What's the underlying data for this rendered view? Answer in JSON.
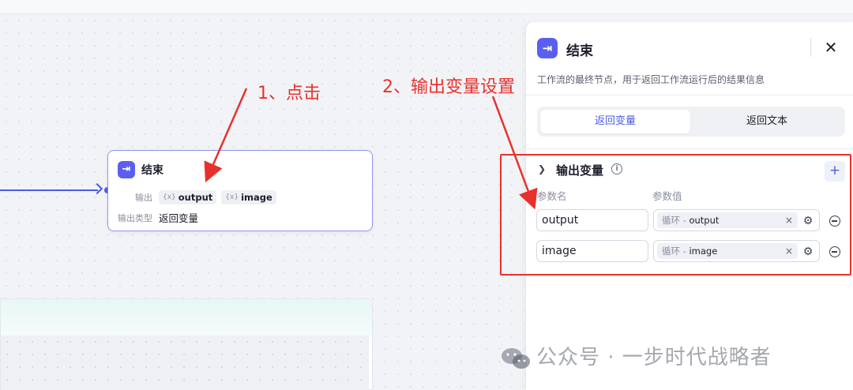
{
  "canvas": {
    "node": {
      "title": "结束",
      "output_label": "输出",
      "outputs": [
        "output",
        "image"
      ],
      "output_type_label": "输出类型",
      "output_type_value": "返回变量"
    }
  },
  "annotations": {
    "step1": "1、点击",
    "step2": "2、输出变量设置"
  },
  "panel": {
    "title": "结束",
    "description": "工作流的最终节点，用于返回工作流运行后的结果信息",
    "tabs": [
      {
        "label": "返回变量",
        "active": true
      },
      {
        "label": "返回文本",
        "active": false
      }
    ],
    "section": {
      "title": "输出变量",
      "col_name": "参数名",
      "col_value": "参数值",
      "rows": [
        {
          "name": "output",
          "source": "循环",
          "value": "output"
        },
        {
          "name": "image",
          "source": "循环",
          "value": "image"
        }
      ]
    }
  },
  "watermark": "公众号 · 一步时代战略者",
  "colors": {
    "accent": "#5b5ff0",
    "annotation": "#e8312c"
  }
}
